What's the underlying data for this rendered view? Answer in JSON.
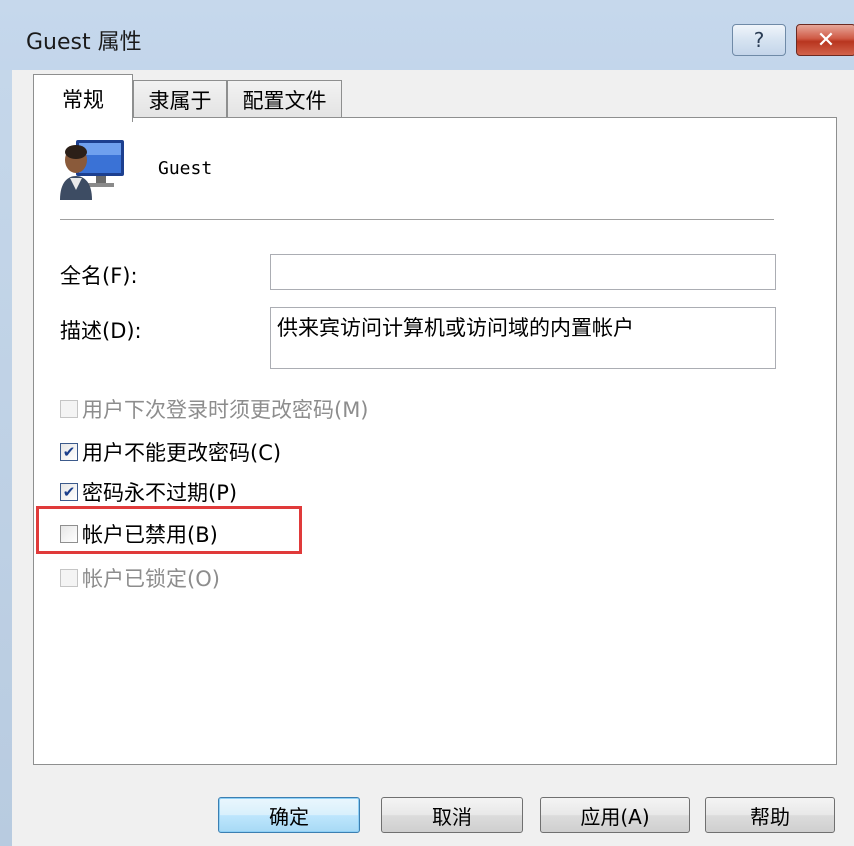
{
  "window": {
    "title": "Guest 属性",
    "help_symbol": "?",
    "close_symbol": "✕"
  },
  "tabs": [
    {
      "label": "常规",
      "active": true
    },
    {
      "label": "隶属于",
      "active": false
    },
    {
      "label": "配置文件",
      "active": false
    }
  ],
  "general": {
    "user_icon": "user-account-icon",
    "username": "Guest",
    "fullname_label": "全名(F):",
    "fullname_value": "",
    "description_label": "描述(D):",
    "description_value": "供来宾访问计算机或访问域的内置帐户"
  },
  "options": [
    {
      "label": "用户下次登录时须更改密码(M)",
      "checked": false,
      "disabled": true
    },
    {
      "label": "用户不能更改密码(C)",
      "checked": true,
      "disabled": false
    },
    {
      "label": "密码永不过期(P)",
      "checked": true,
      "disabled": false
    },
    {
      "label": "帐户已禁用(B)",
      "checked": false,
      "disabled": false
    },
    {
      "label": "帐户已锁定(O)",
      "checked": false,
      "disabled": true
    }
  ],
  "buttons": {
    "ok": "确定",
    "cancel": "取消",
    "apply": "应用(A)",
    "help": "帮助"
  },
  "colors": {
    "highlight": "#e03a3a",
    "close_button": "#c74a33",
    "check_mark": "#1b3f8c"
  }
}
